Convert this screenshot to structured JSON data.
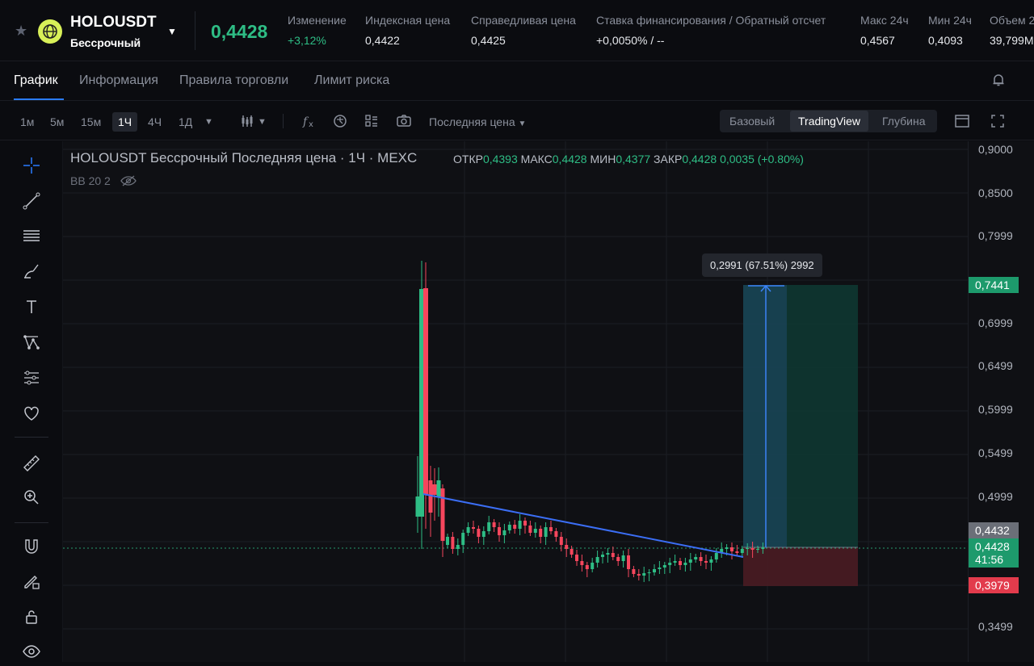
{
  "header": {
    "symbol": "HOLOUSDT",
    "contract_type": "Бессрочный",
    "last_price": "0,4428",
    "stats": [
      {
        "label": "Изменение",
        "value": "+3,12%",
        "color": "#2ebd85"
      },
      {
        "label": "Индексная цена",
        "value": "0,4422"
      },
      {
        "label": "Справедливая цена",
        "value": "0,4425"
      },
      {
        "label": "Ставка финансирования / Обратный отсчет",
        "value": "+0,0050% / --"
      },
      {
        "label": "Макс 24ч",
        "value": "0,4567"
      },
      {
        "label": "Мин 24ч",
        "value": "0,4093"
      },
      {
        "label": "Объем 2",
        "value": "39,799M"
      }
    ]
  },
  "tabs": [
    "График",
    "Информация",
    "Правила торговли",
    "Лимит риска"
  ],
  "toolbar": {
    "timeframes": [
      "1м",
      "5м",
      "15м",
      "1Ч",
      "4Ч",
      "1Д"
    ],
    "active_timeframe": "1Ч",
    "price_type": "Последняя цена",
    "views": [
      "Базовый",
      "TradingView",
      "Глубина"
    ],
    "active_view": "TradingView",
    "icons": [
      "candles-icon",
      "indicators-icon",
      "alerts-icon",
      "templates-icon",
      "camera-icon"
    ]
  },
  "left_tools": [
    "crosshair-icon",
    "trendline-icon",
    "channel-icon",
    "brush-icon",
    "text-icon",
    "pattern-icon",
    "fib-icon",
    "heart-icon",
    "ruler-icon",
    "zoom-icon",
    "magnet-icon",
    "lock-draw-icon",
    "lock-icon",
    "eye-icon"
  ],
  "chart": {
    "legend": "HOLOUSDT Бессрочный Последняя цена · 1Ч · MEXC",
    "ohlc": {
      "open_label": "ОТКР",
      "open": "0,4393",
      "high_label": "МАКС",
      "high": "0,4428",
      "low_label": "МИН",
      "low": "0,4377",
      "close_label": "ЗАКР",
      "close": "0,4428",
      "change": "0,0035 (+0.80%)"
    },
    "indicator": "BB 20 2",
    "measure_label": "0,2991 (67.51%) 2992",
    "axis_ticks": [
      "0,9000",
      "0,8500",
      "0,7999",
      "0,6999",
      "0,6499",
      "0,5999",
      "0,5499",
      "0,4999",
      "0,3499"
    ],
    "price_tags": {
      "target": "0,7441",
      "index": "0,4432",
      "last": "0,4428",
      "countdown": "41:56",
      "stop": "0,3979"
    },
    "colors": {
      "up": "#2ebd85",
      "down": "#f6465d",
      "trendline": "#3b6ef5"
    }
  }
}
